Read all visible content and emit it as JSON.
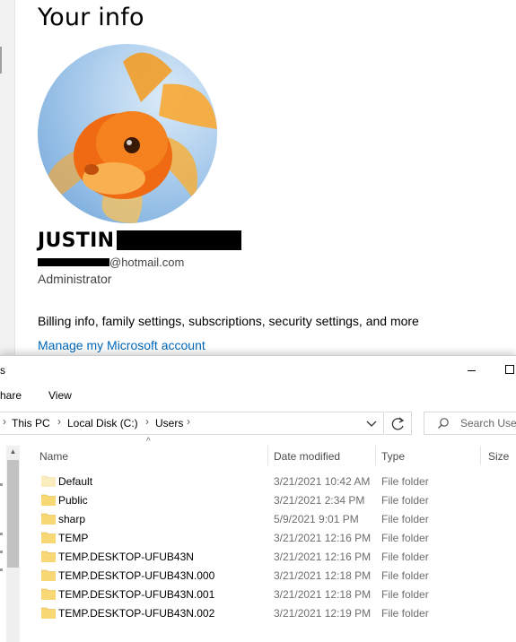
{
  "settings": {
    "title": "Your info",
    "user_name": "JUSTIN",
    "email_suffix": "@hotmail.com",
    "role": "Administrator",
    "billing_text": "Billing info, family settings, subscriptions, security settings, and more",
    "manage_link": "Manage my Microsoft account",
    "link_color": "#0067b8"
  },
  "explorer": {
    "title_fragment": "s",
    "ribbon": {
      "share": "hare",
      "view": "View"
    },
    "breadcrumb": [
      "This PC",
      "Local Disk (C:)",
      "Users"
    ],
    "search_placeholder": "Search Users",
    "columns": {
      "name": "Name",
      "date": "Date modified",
      "type": "Type",
      "size": "Size"
    },
    "files": [
      {
        "name": "Default",
        "date": "3/21/2021 10:42 AM",
        "type": "File folder",
        "faded": true
      },
      {
        "name": "Public",
        "date": "3/21/2021 2:34 PM",
        "type": "File folder",
        "faded": false
      },
      {
        "name": "sharp",
        "date": "5/9/2021 9:01 PM",
        "type": "File folder",
        "faded": false
      },
      {
        "name": "TEMP",
        "date": "3/21/2021 12:16 PM",
        "type": "File folder",
        "faded": false
      },
      {
        "name": "TEMP.DESKTOP-UFUB43N",
        "date": "3/21/2021 12:16 PM",
        "type": "File folder",
        "faded": false
      },
      {
        "name": "TEMP.DESKTOP-UFUB43N.000",
        "date": "3/21/2021 12:18 PM",
        "type": "File folder",
        "faded": false
      },
      {
        "name": "TEMP.DESKTOP-UFUB43N.001",
        "date": "3/21/2021 12:18 PM",
        "type": "File folder",
        "faded": false
      },
      {
        "name": "TEMP.DESKTOP-UFUB43N.002",
        "date": "3/21/2021 12:19 PM",
        "type": "File folder",
        "faded": false
      }
    ],
    "folder_color": "#f8d775"
  }
}
